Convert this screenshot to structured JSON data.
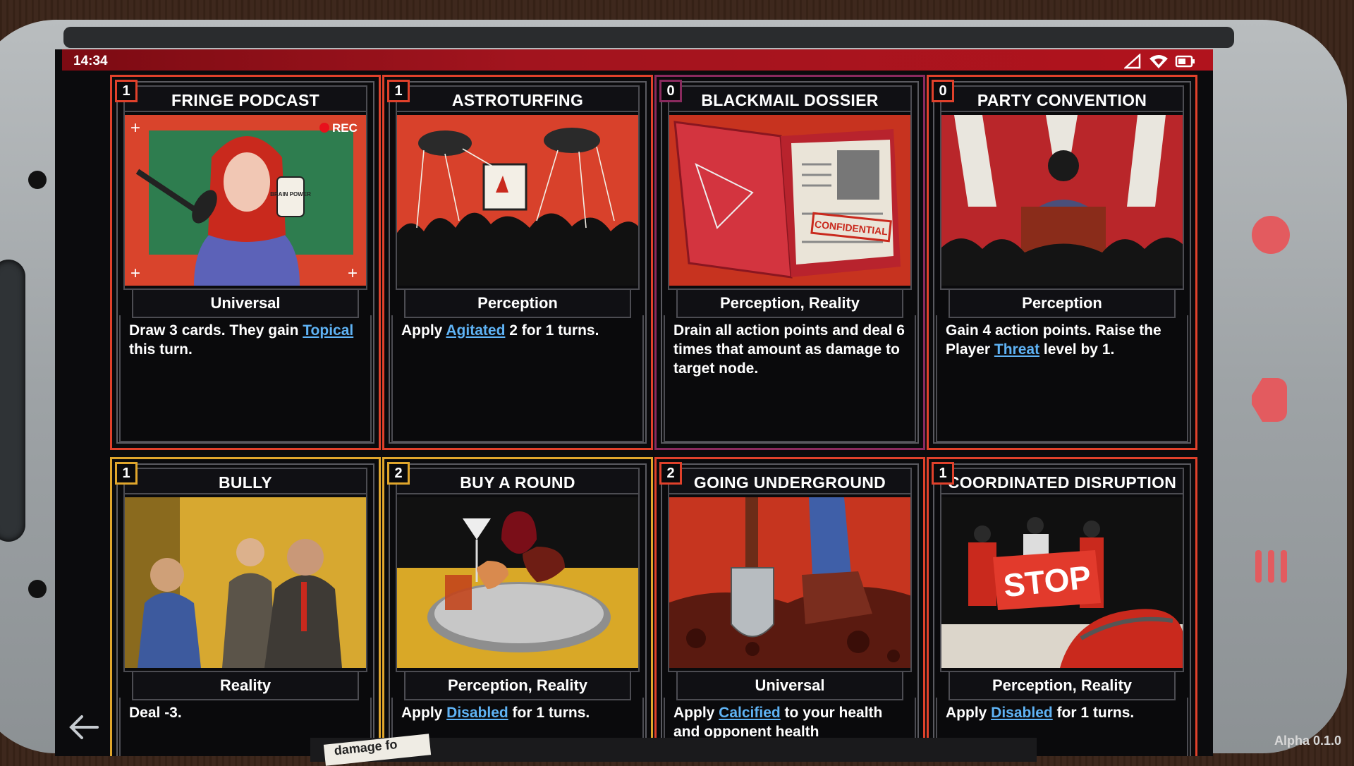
{
  "status": {
    "time": "14:34"
  },
  "cards": [
    {
      "cost": "1",
      "title": "FRINGE PODCAST",
      "tags": "Universal",
      "desc": [
        {
          "t": "Draw 3 cards. They gain "
        },
        {
          "t": "Topical",
          "kw": true
        },
        {
          "t": " this turn."
        }
      ],
      "accent": "#e0412b",
      "art": "podcast",
      "art_text": [
        "REC",
        "BRAIN POWER"
      ]
    },
    {
      "cost": "1",
      "title": "ASTROTURFING",
      "tags": "Perception",
      "desc": [
        {
          "t": "Apply "
        },
        {
          "t": "Agitated",
          "kw": true
        },
        {
          "t": " 2 for 1 turns."
        }
      ],
      "accent": "#e0412b",
      "art": "puppets"
    },
    {
      "cost": "0",
      "title": "BLACKMAIL DOSSIER",
      "tags": "Perception, Reality",
      "desc": [
        {
          "t": "Drain all action points and deal 6 times that amount as damage to target node."
        }
      ],
      "accent": "#8a2a5e",
      "art": "dossier",
      "art_text": [
        "CONFIDENTIAL"
      ]
    },
    {
      "cost": "0",
      "title": "PARTY CONVENTION",
      "tags": "Perception",
      "desc": [
        {
          "t": "Gain 4 action points. Raise the Player "
        },
        {
          "t": "Threat",
          "kw": true
        },
        {
          "t": " level by 1."
        }
      ],
      "accent": "#e0412b",
      "art": "convention"
    },
    {
      "cost": "1",
      "title": "BULLY",
      "tags": "Reality",
      "desc": [
        {
          "t": "Deal -3."
        }
      ],
      "accent": "#e0a62c",
      "art": "bully"
    },
    {
      "cost": "2",
      "title": "BUY A ROUND",
      "tags": "Perception, Reality",
      "desc": [
        {
          "t": "Apply "
        },
        {
          "t": "Disabled",
          "kw": true
        },
        {
          "t": " for 1 turns."
        }
      ],
      "accent": "#e0a62c",
      "art": "drinks"
    },
    {
      "cost": "2",
      "title": "GOING UNDERGROUND",
      "tags": "Universal",
      "desc": [
        {
          "t": "Apply "
        },
        {
          "t": "Calcified",
          "kw": true
        },
        {
          "t": " to your health and opponent health"
        }
      ],
      "accent": "#e0412b",
      "art": "shovel"
    },
    {
      "cost": "1",
      "title": "COORDINATED DISRUPTION",
      "tags": "Perception, Reality",
      "desc": [
        {
          "t": "Apply "
        },
        {
          "t": "Disabled",
          "kw": true
        },
        {
          "t": " for 1 turns."
        }
      ],
      "accent": "#e0412b",
      "art": "protest",
      "art_text": [
        "STOP"
      ]
    }
  ],
  "footer": {
    "peek_text": "damage fo",
    "version": "Alpha 0.1.0"
  },
  "icons": [
    "signal-icon",
    "wifi-icon",
    "battery-icon",
    "back-arrow-icon"
  ]
}
